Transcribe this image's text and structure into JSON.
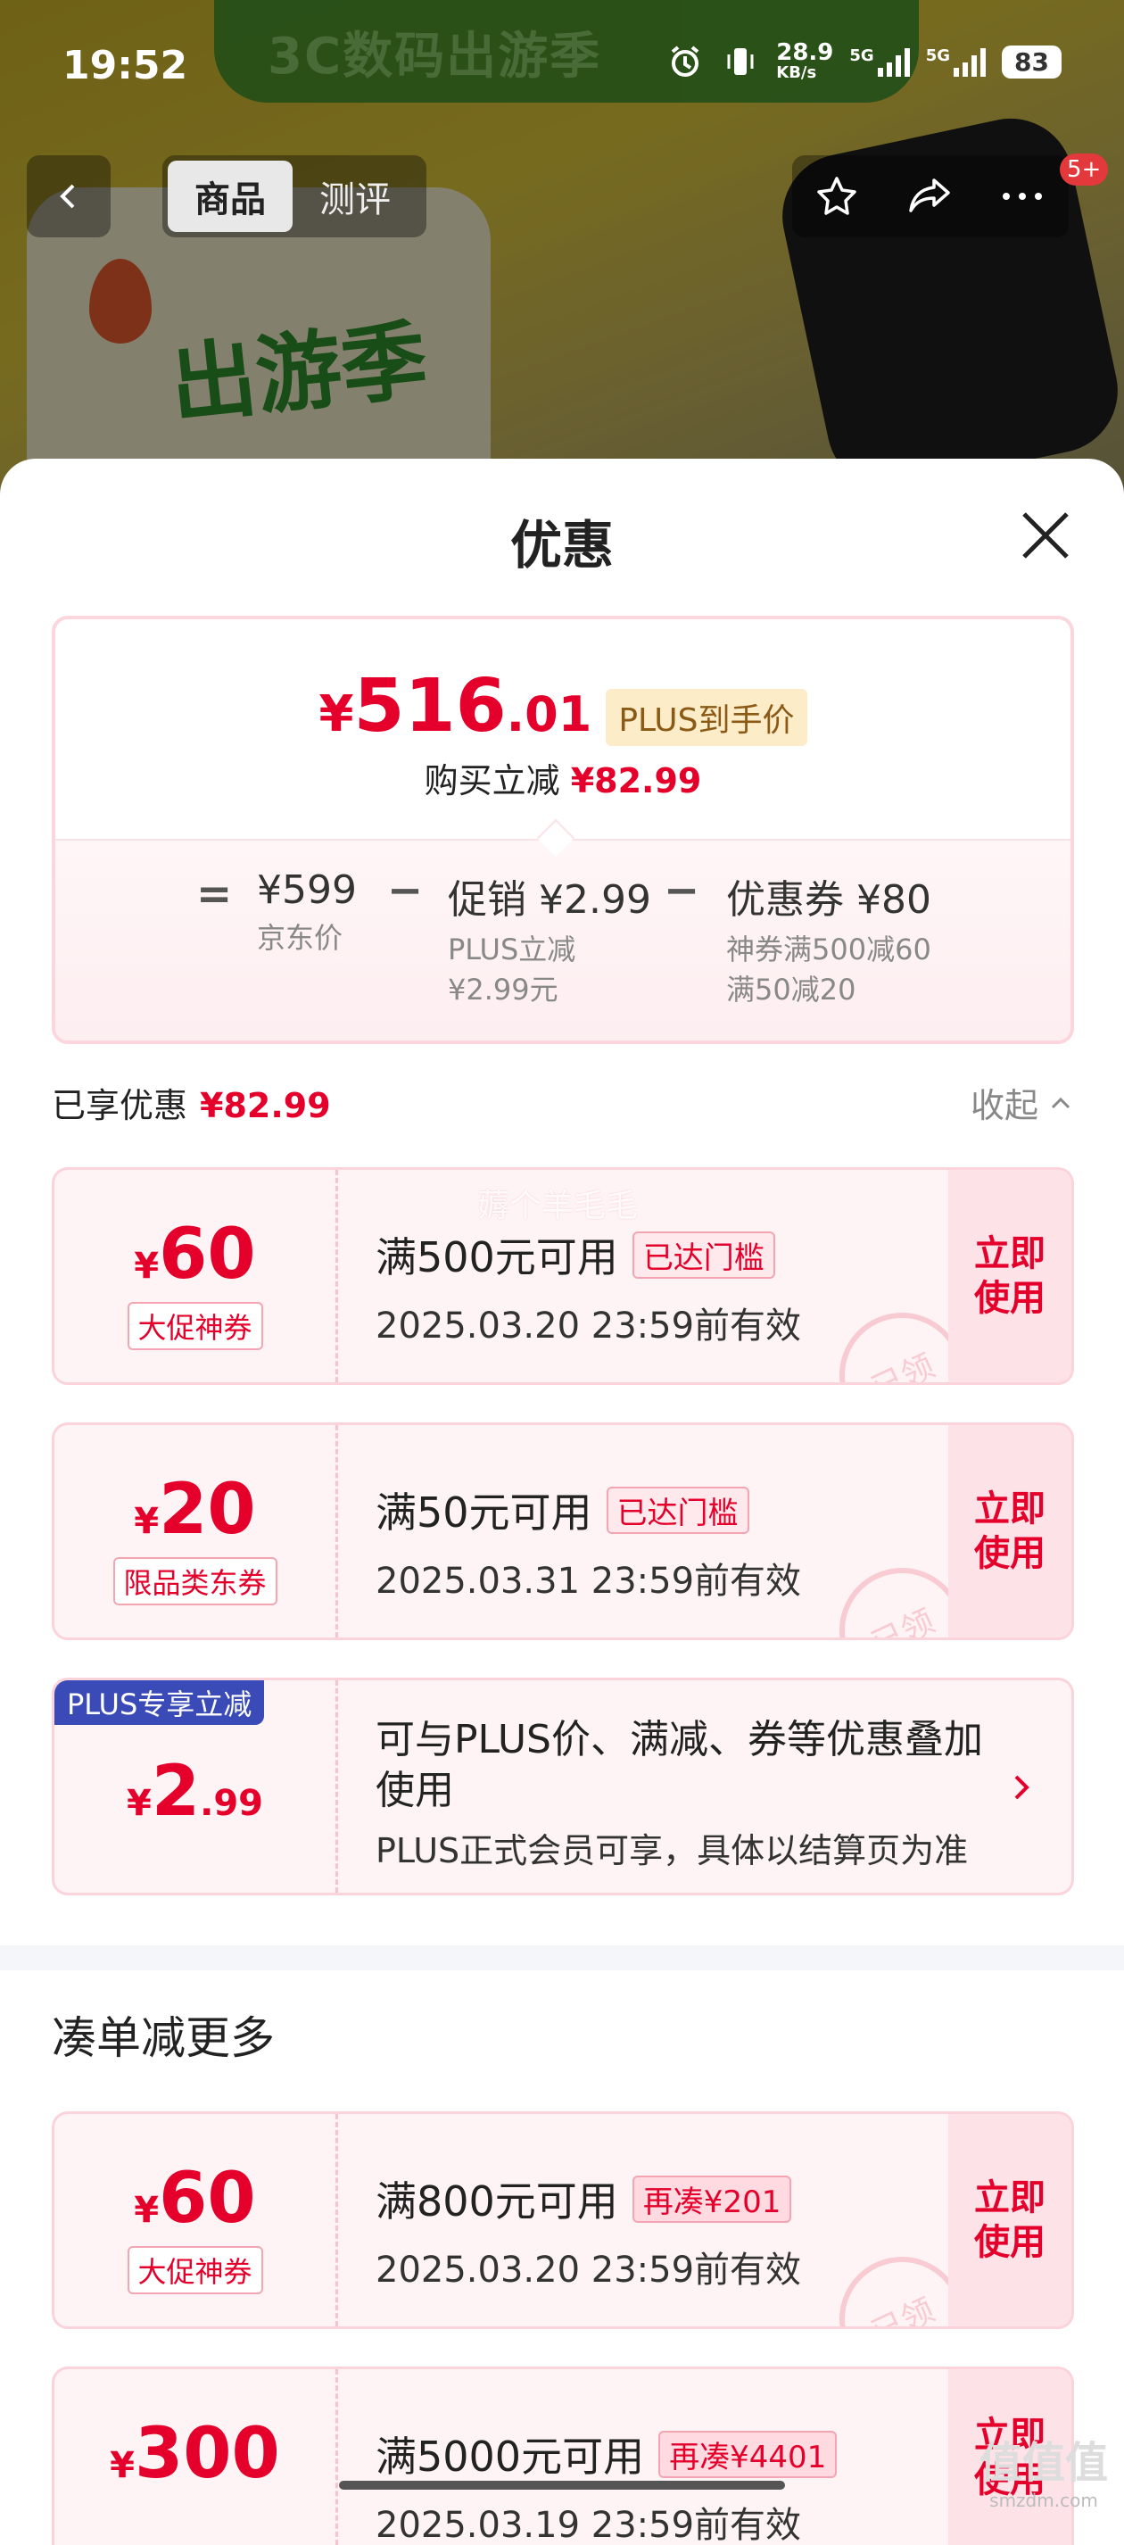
{
  "status_bar": {
    "time": "19:52",
    "speed_value": "28.9",
    "speed_unit": "KB/s",
    "net1": "5G",
    "net2": "5G",
    "battery": "83"
  },
  "background": {
    "banner_text": "3C数码出游季",
    "logo_text": "出游季"
  },
  "nav": {
    "tabs": [
      {
        "label": "商品"
      },
      {
        "label": "测评"
      }
    ],
    "badge": "5+"
  },
  "sheet": {
    "title": "优惠",
    "summary": {
      "price_symbol": "¥",
      "price_int": "516",
      "price_dec": ".01",
      "plus_tag": "PLUS到手价",
      "reduce_label": "购买立减",
      "reduce_value": "¥82.99",
      "formula": {
        "eq": "=",
        "jd_price": "¥599",
        "jd_price_label": "京东价",
        "minus1": "−",
        "promo": "促销 ¥2.99",
        "promo_sub1": "PLUS立减",
        "promo_sub2": "¥2.99元",
        "minus2": "−",
        "coupon": "优惠券 ¥80",
        "coupon_sub1": "神券满500减60",
        "coupon_sub2": "满50减20"
      }
    },
    "enjoyed": {
      "label": "已享优惠",
      "value": "¥82.99",
      "collapse": "收起"
    },
    "watermark": "薅个羊毛毛",
    "coupons": [
      {
        "sym": "¥",
        "amount": "60",
        "type": "大促神券",
        "cond": "满500元可用",
        "tag": "已达门槛",
        "date": "2025.03.20 23:59前有效",
        "use": "立即使用",
        "stamp": "已领"
      },
      {
        "sym": "¥",
        "amount": "20",
        "type": "限品类东券",
        "cond": "满50元可用",
        "tag": "已达门槛",
        "date": "2025.03.31 23:59前有效",
        "use": "立即使用",
        "stamp": "已领"
      }
    ],
    "plus_offer": {
      "label": "PLUS专享立减",
      "sym": "¥",
      "amount": "2",
      "dec": ".99",
      "desc": "可与PLUS价、满减、券等优惠叠加使用",
      "note": "PLUS正式会员可享，具体以结算页为准"
    },
    "more_title": "凑单减更多",
    "more_coupons": [
      {
        "sym": "¥",
        "amount": "60",
        "type": "大促神券",
        "cond": "满800元可用",
        "tag": "再凑¥201",
        "date": "2025.03.20 23:59前有效",
        "use": "立即使用",
        "stamp": "已领"
      },
      {
        "sym": "¥",
        "amount": "300",
        "type": "",
        "cond": "满5000元可用",
        "tag": "再凑¥4401",
        "date": "2025.03.19 23:59前有效",
        "use": "立即使用",
        "stamp": ""
      }
    ]
  },
  "corner_watermark": {
    "big": "值值值",
    "small": "smzdm.com"
  }
}
